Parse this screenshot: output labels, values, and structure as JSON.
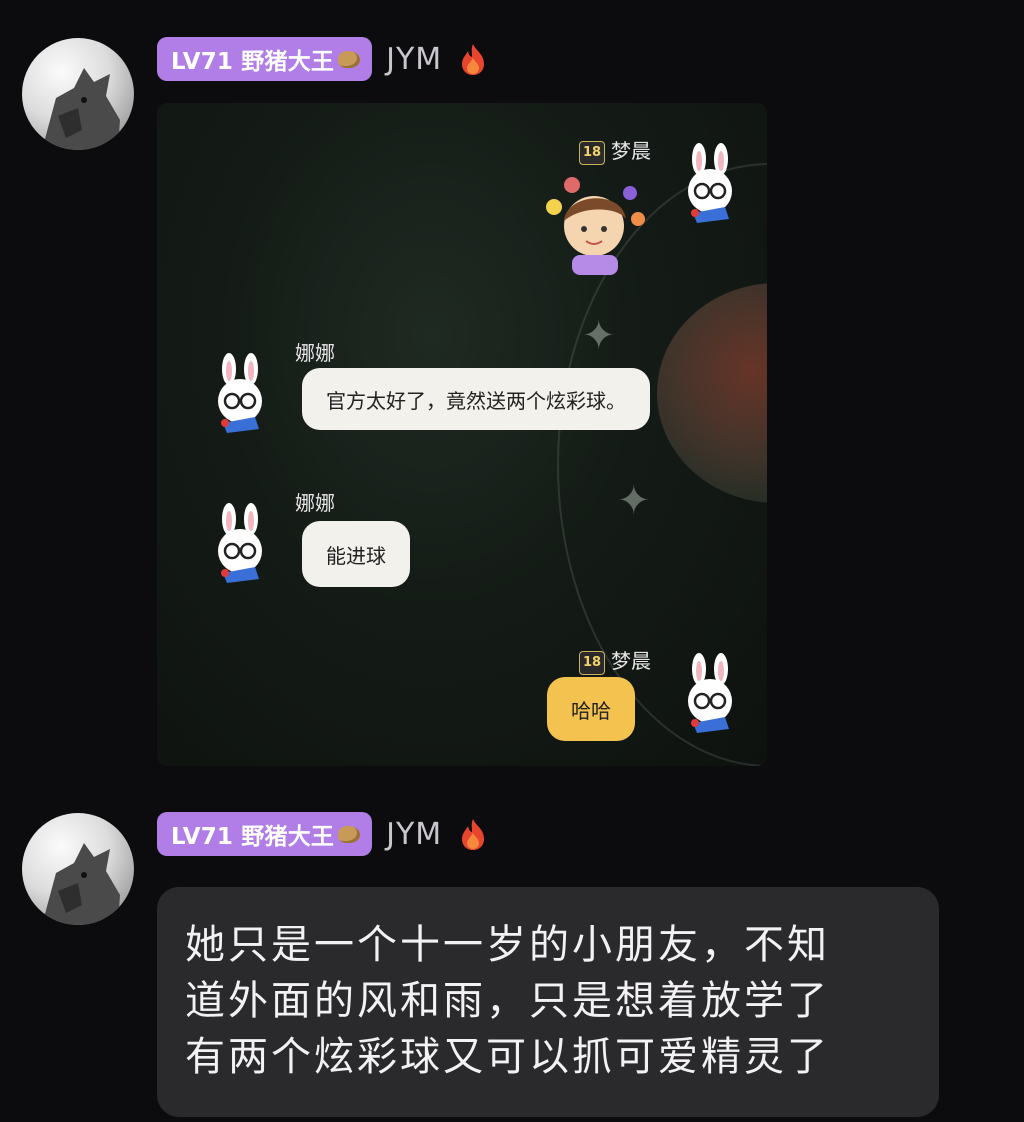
{
  "messages": [
    {
      "level_badge": "LV71 野猪大王",
      "username": "JYM",
      "screenshot": {
        "chat": [
          {
            "sender": "梦晨",
            "rank": "18",
            "side": "right",
            "type": "sticker"
          },
          {
            "sender": "娜娜",
            "side": "left",
            "text": "官方太好了，竟然送两个炫彩球。"
          },
          {
            "sender": "娜娜",
            "side": "left",
            "text": "能进球"
          },
          {
            "sender": "梦晨",
            "rank": "18",
            "side": "right",
            "text": "哈哈"
          }
        ]
      }
    },
    {
      "level_badge": "LV71 野猪大王",
      "username": "JYM",
      "lines": [
        "她只是一个十一岁的小朋友，不知",
        "道外面的风和雨，只是想着放学了",
        "有两个炫彩球又可以抓可爱精灵了"
      ]
    }
  ],
  "colors": {
    "background": "#0c0b0e",
    "level_badge": "#b07ee6",
    "bubble_dark": "#2a2a2d",
    "bubble_white": "#f3f1ec",
    "bubble_yellow": "#f4c24e"
  },
  "icons": [
    "fire-icon",
    "potato-icon",
    "bunny-avatar-icon",
    "rank-badge-icon"
  ]
}
